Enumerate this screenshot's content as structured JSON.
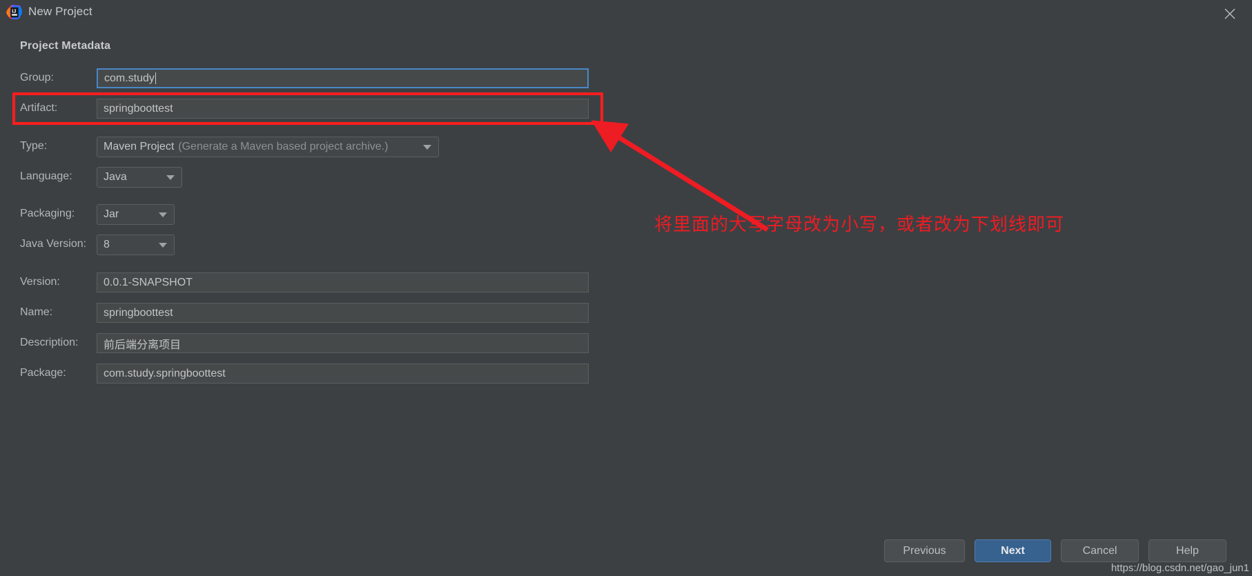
{
  "window": {
    "title": "New Project",
    "app_icon": "intellij-idea-logo",
    "close_icon": "close-icon"
  },
  "section": {
    "title": "Project Metadata"
  },
  "form": {
    "fields": [
      {
        "label": "Group:",
        "value": "com.study",
        "kind": "text",
        "focused": true,
        "name": "group"
      },
      {
        "label": "Artifact:",
        "value": "springboottest",
        "kind": "text",
        "focused": false,
        "name": "artifact"
      },
      {
        "label": "Type:",
        "value": "Maven Project",
        "hint": "(Generate a Maven based project archive.)",
        "kind": "combo",
        "name": "type"
      },
      {
        "label": "Language:",
        "value": "Java",
        "kind": "combo",
        "name": "language"
      },
      {
        "label": "Packaging:",
        "value": "Jar",
        "kind": "combo",
        "name": "packaging"
      },
      {
        "label": "Java Version:",
        "value": "8",
        "kind": "combo",
        "name": "java-version"
      },
      {
        "label": "Version:",
        "value": "0.0.1-SNAPSHOT",
        "kind": "text",
        "focused": false,
        "name": "version"
      },
      {
        "label": "Name:",
        "value": "springboottest",
        "kind": "text",
        "focused": false,
        "name": "name"
      },
      {
        "label": "Description:",
        "value": "前后端分离项目",
        "kind": "text",
        "focused": false,
        "name": "description"
      },
      {
        "label": "Package:",
        "value": "com.study.springboottest",
        "kind": "text",
        "focused": false,
        "name": "package"
      }
    ]
  },
  "footer": {
    "previous_label": "Previous",
    "next_label": "Next",
    "cancel_label": "Cancel",
    "help_label": "Help"
  },
  "annotation": {
    "text": "将里面的大写字母改为小写，或者改为下划线即可",
    "color": "#ee1c23",
    "highlight_target": "artifact-row"
  },
  "watermark": {
    "text": "https://blog.csdn.net/gao_jun1"
  },
  "colors": {
    "window_bg": "#3c4043",
    "field_bg": "#45494a",
    "accent_blue": "#37618f",
    "focus_border": "#4a88c7",
    "annotation_red": "#ee1c23"
  }
}
